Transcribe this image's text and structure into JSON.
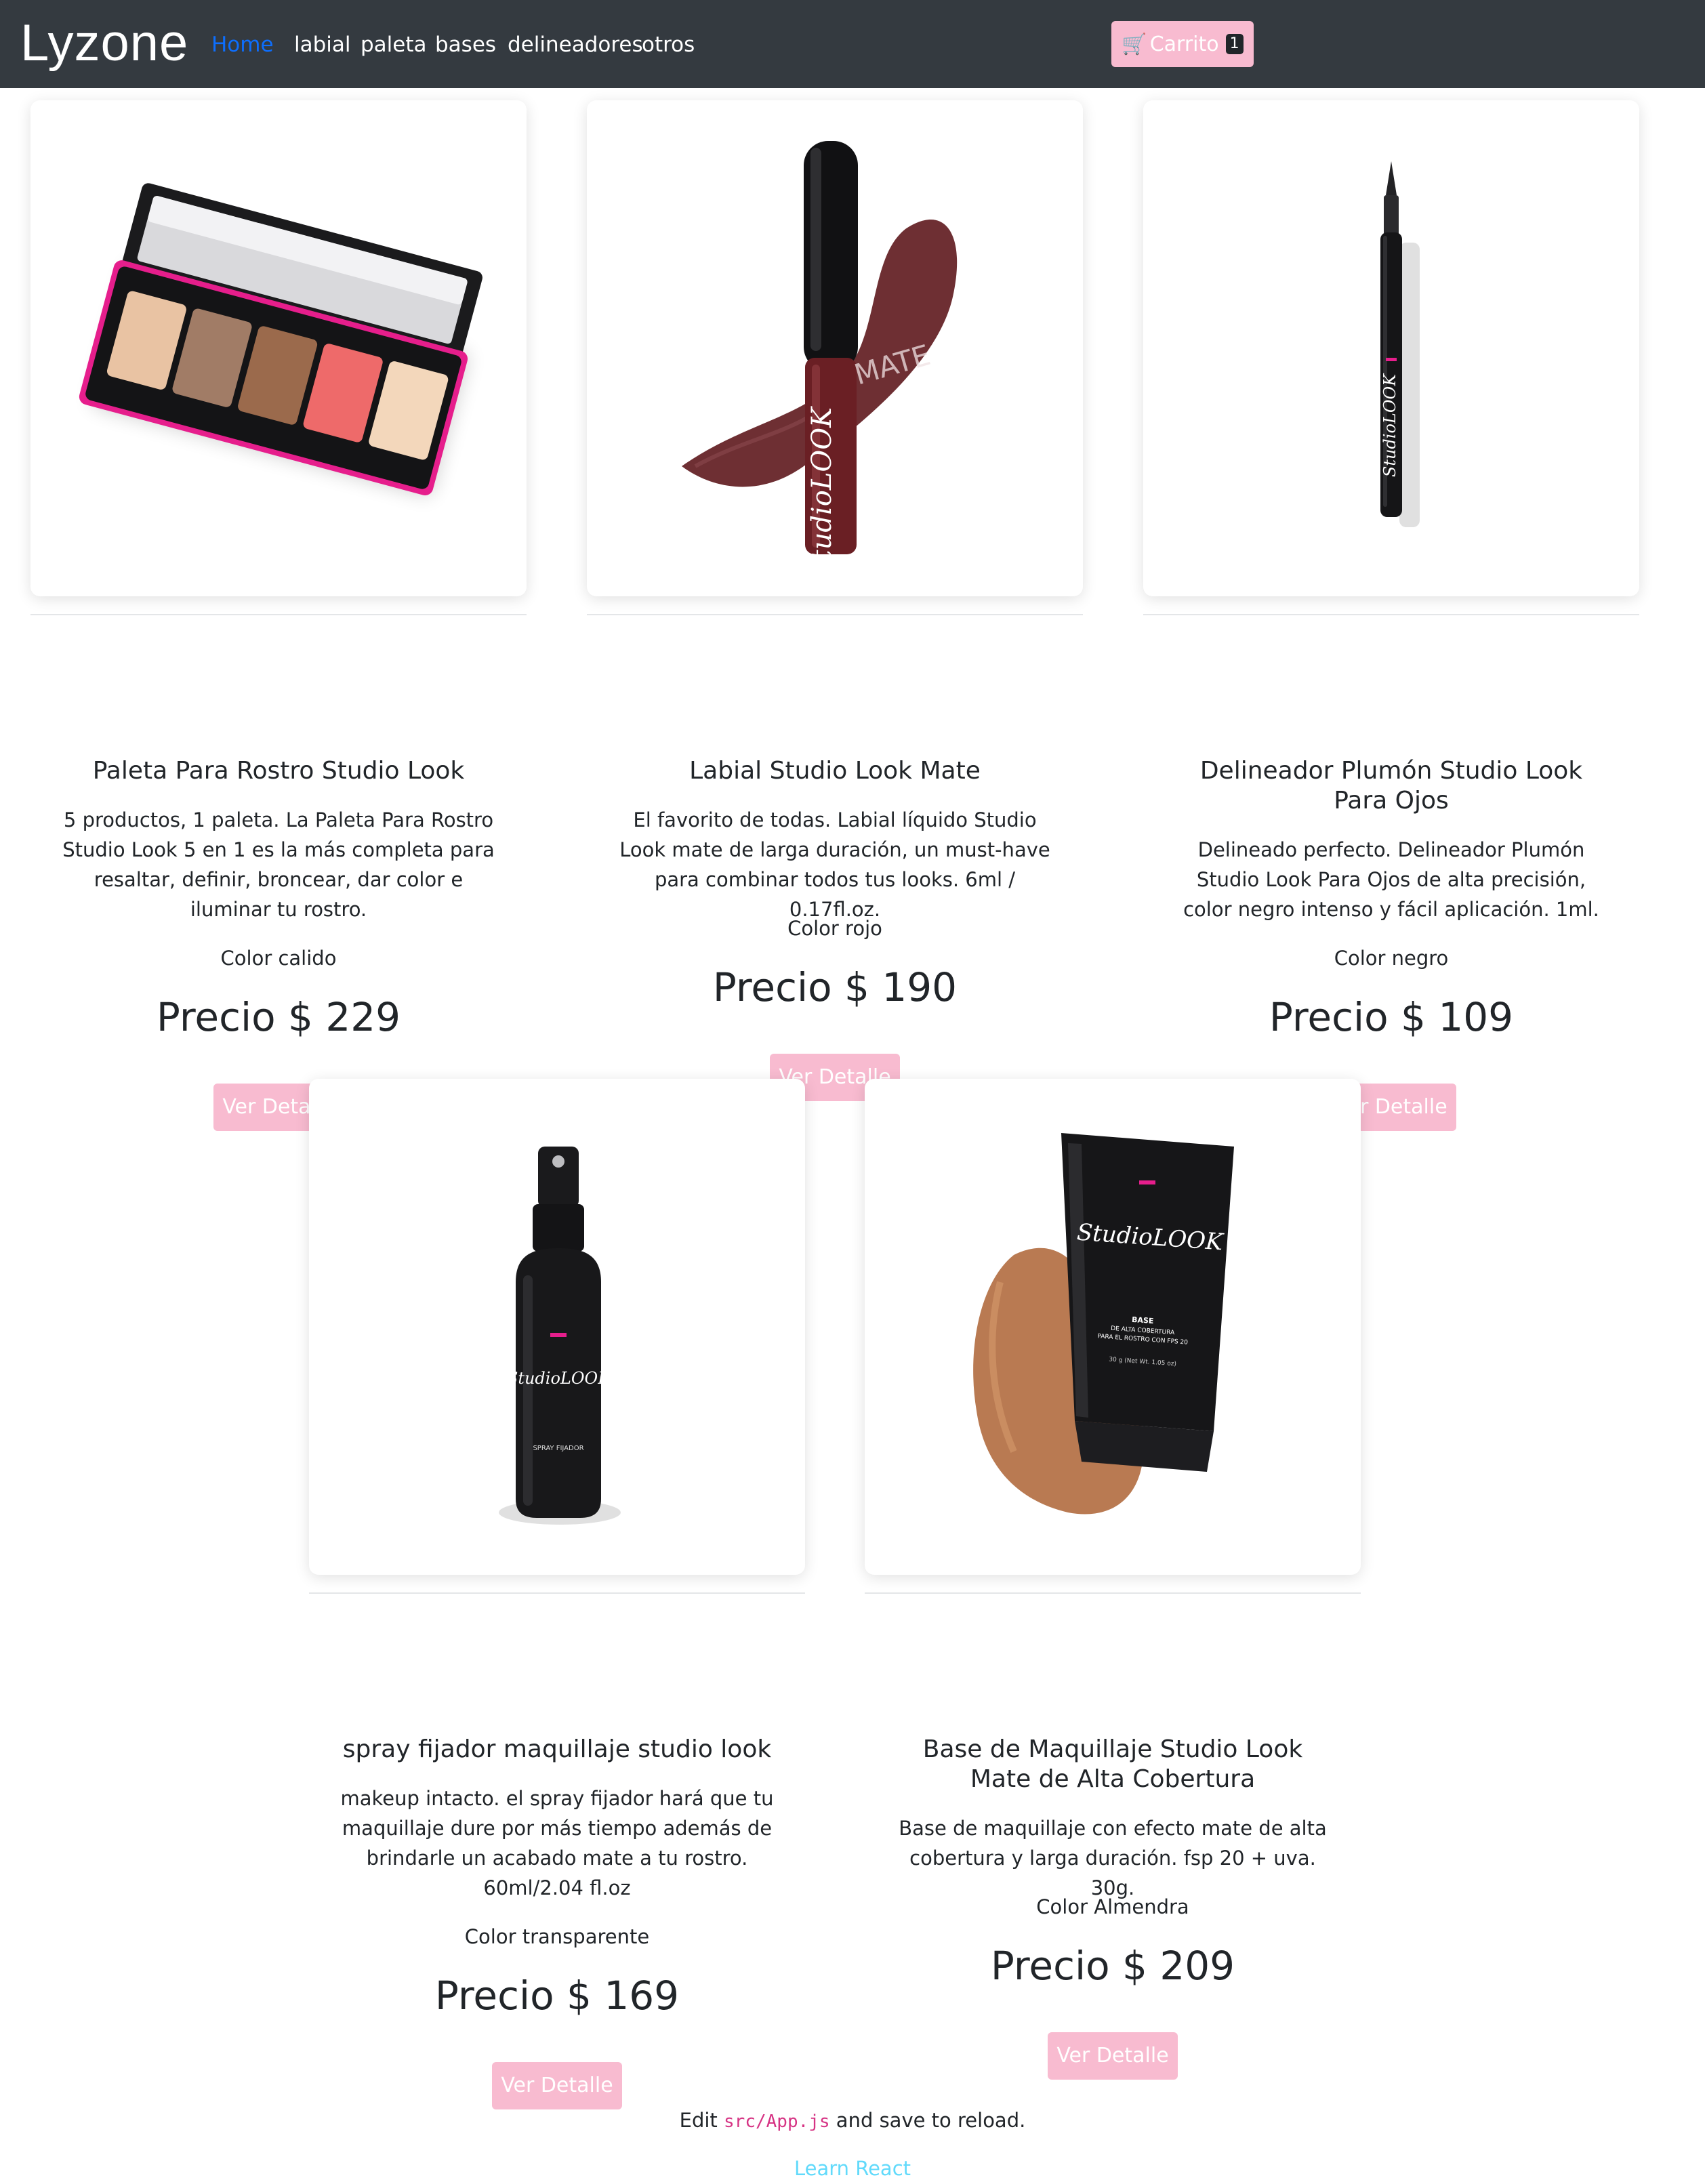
{
  "nav": {
    "brand": "Lyzone",
    "links": [
      "Home",
      "labial",
      "paleta",
      "bases",
      "delineadores",
      "otros"
    ],
    "cart_label": "Carrito",
    "cart_count": "1",
    "cart_icon": "shopping-cart-icon"
  },
  "products": [
    {
      "title": "Paleta Para Rostro Studio Look",
      "description": "5 productos, 1 paleta. La Paleta Para Rostro Studio Look 5 en 1 es la más completa para resaltar, definir, broncear, dar color e iluminar tu rostro.",
      "color": "Color calido",
      "price": "Precio $ 229",
      "button": "Ver Detalle",
      "image": "face-palette"
    },
    {
      "title": "Labial Studio Look Mate",
      "description": "El favorito de todas. Labial líquido Studio Look mate de larga duración, un must-have para combinar todos tus looks. 6ml / 0.17fl.oz.",
      "color": "Color rojo",
      "price": "Precio $ 190",
      "button": "Ver Detalle",
      "image": "liquid-lipstick",
      "image_text": [
        "MATE",
        "StudioLOOK"
      ]
    },
    {
      "title": "Delineador Plumón Studio Look Para Ojos",
      "description": "Delineado perfecto. Delineador Plumón Studio Look Para Ojos de alta precisión, color negro intenso y fácil aplicación. 1ml.",
      "color": "Color negro",
      "price": "Precio $ 109",
      "button": "Ver Detalle",
      "image": "eyeliner-pen",
      "image_text": [
        "StudioLOOK"
      ]
    },
    {
      "title": "spray fijador maquillaje studio look",
      "description": "makeup intacto. el spray fijador hará que tu maquillaje dure por más tiempo además de brindarle un acabado mate a tu rostro. 60ml/2.04 fl.oz",
      "color": "Color transparente",
      "price": "Precio $ 169",
      "button": "Ver Detalle",
      "image": "setting-spray",
      "image_text": [
        "StudioLOOK",
        "SPRAY FIJADOR"
      ]
    },
    {
      "title": "Base de Maquillaje Studio Look Mate de Alta Cobertura",
      "description": "Base de maquillaje con efecto mate de alta cobertura y larga duración. fsp 20 + uva. 30g.",
      "color": "Color Almendra",
      "price": "Precio $ 209",
      "button": "Ver Detalle",
      "image": "foundation-tube",
      "image_text": [
        "StudioLOOK",
        "BASE",
        "DE ALTA COBERTURA",
        "PARA EL ROSTRO CON FPS 20",
        "30 g (Net Wt. 1.05 oz)"
      ]
    }
  ],
  "footer": {
    "edit_prefix": "Edit",
    "edit_code": "src/App.js",
    "edit_suffix": "and save to reload.",
    "learn_link": "Learn React"
  },
  "colors": {
    "navbar": "#343a40",
    "accent_pink": "#f8bbd0",
    "active_link": "#0d6efd",
    "link_cyan": "#61dafb",
    "code_pink": "#d63384"
  }
}
